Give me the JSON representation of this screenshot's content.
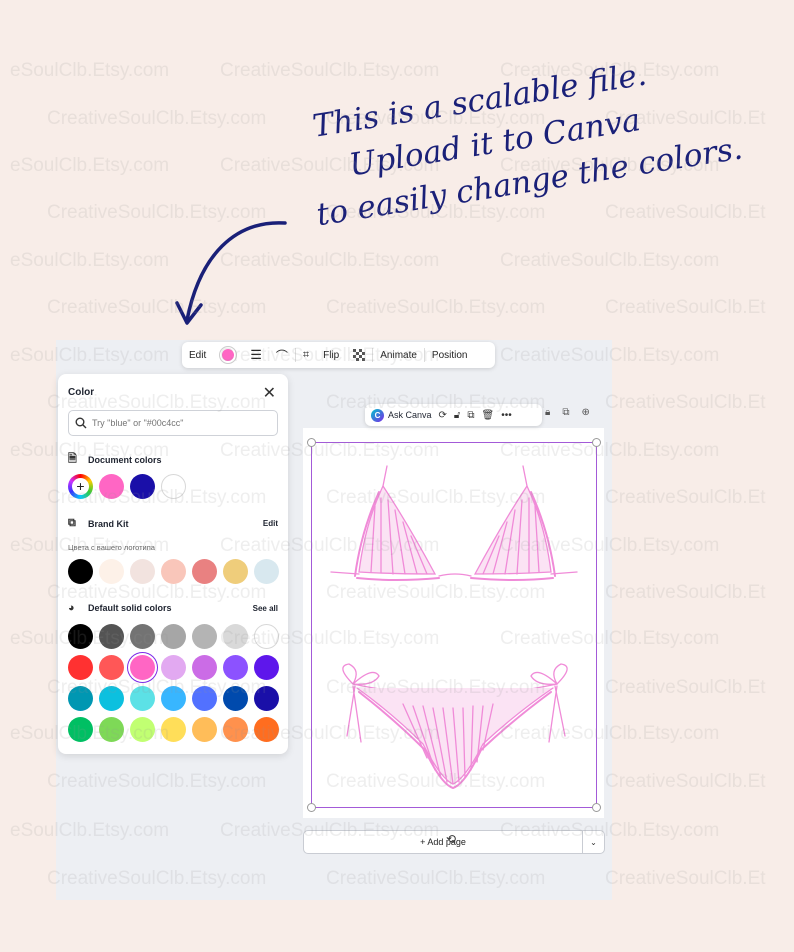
{
  "watermark_text": "CreativeSoulClb.Etsy.com",
  "watermark_text_short": "eSoulClb.Etsy.com",
  "watermark_text_cut": "CreativeSoulClb.Et",
  "headline": {
    "line1": "This is a scalable file.",
    "line2": "Upload it to Canva",
    "line3": "to easily change the colors."
  },
  "toolbar": {
    "edit": "Edit",
    "current_color": "#ff66c4",
    "flip": "Flip",
    "animate": "Animate",
    "position": "Position"
  },
  "color_panel": {
    "title": "Color",
    "search_placeholder": "Try \"blue\" or \"#00c4cc\"",
    "document_colors": {
      "label": "Document colors",
      "colors": [
        "#ff66c4",
        "#1a0fa8",
        "#ffffff"
      ]
    },
    "brand_kit": {
      "label": "Brand Kit",
      "edit": "Edit",
      "sublabel": "Цвета с вашего логотипа",
      "colors": [
        "#000000",
        "#fdf1e8",
        "#f2e3df",
        "#f9c6ba",
        "#e98181",
        "#efcd7b",
        "#d8e8ef"
      ]
    },
    "default_colors": {
      "label": "Default solid colors",
      "see_all": "See all",
      "rows": [
        [
          "#000000",
          "#545454",
          "#737373",
          "#a6a6a6",
          "#b4b4b4",
          "#d9d9d9",
          "#ffffff"
        ],
        [
          "#ff3131",
          "#ff5757",
          "#ff66c4",
          "#e2a9f1",
          "#cb6ce6",
          "#8c52ff",
          "#5e17eb"
        ],
        [
          "#0097b2",
          "#0cc0df",
          "#5ce1e6",
          "#38b6ff",
          "#5271ff",
          "#004aad",
          "#1a0fa8"
        ],
        [
          "#00bf63",
          "#7ed957",
          "#c1ff72",
          "#ffde59",
          "#ffbd59",
          "#ff914d",
          "#ff6d1f"
        ]
      ],
      "selected_color": "#ff66c4"
    }
  },
  "ask_canva": {
    "label": "Ask Canva"
  },
  "add_page": {
    "label": "+ Add page"
  },
  "colors": {
    "sketch": "#f08bd8",
    "accent": "#7d2ae8",
    "headline": "#1a2078"
  }
}
